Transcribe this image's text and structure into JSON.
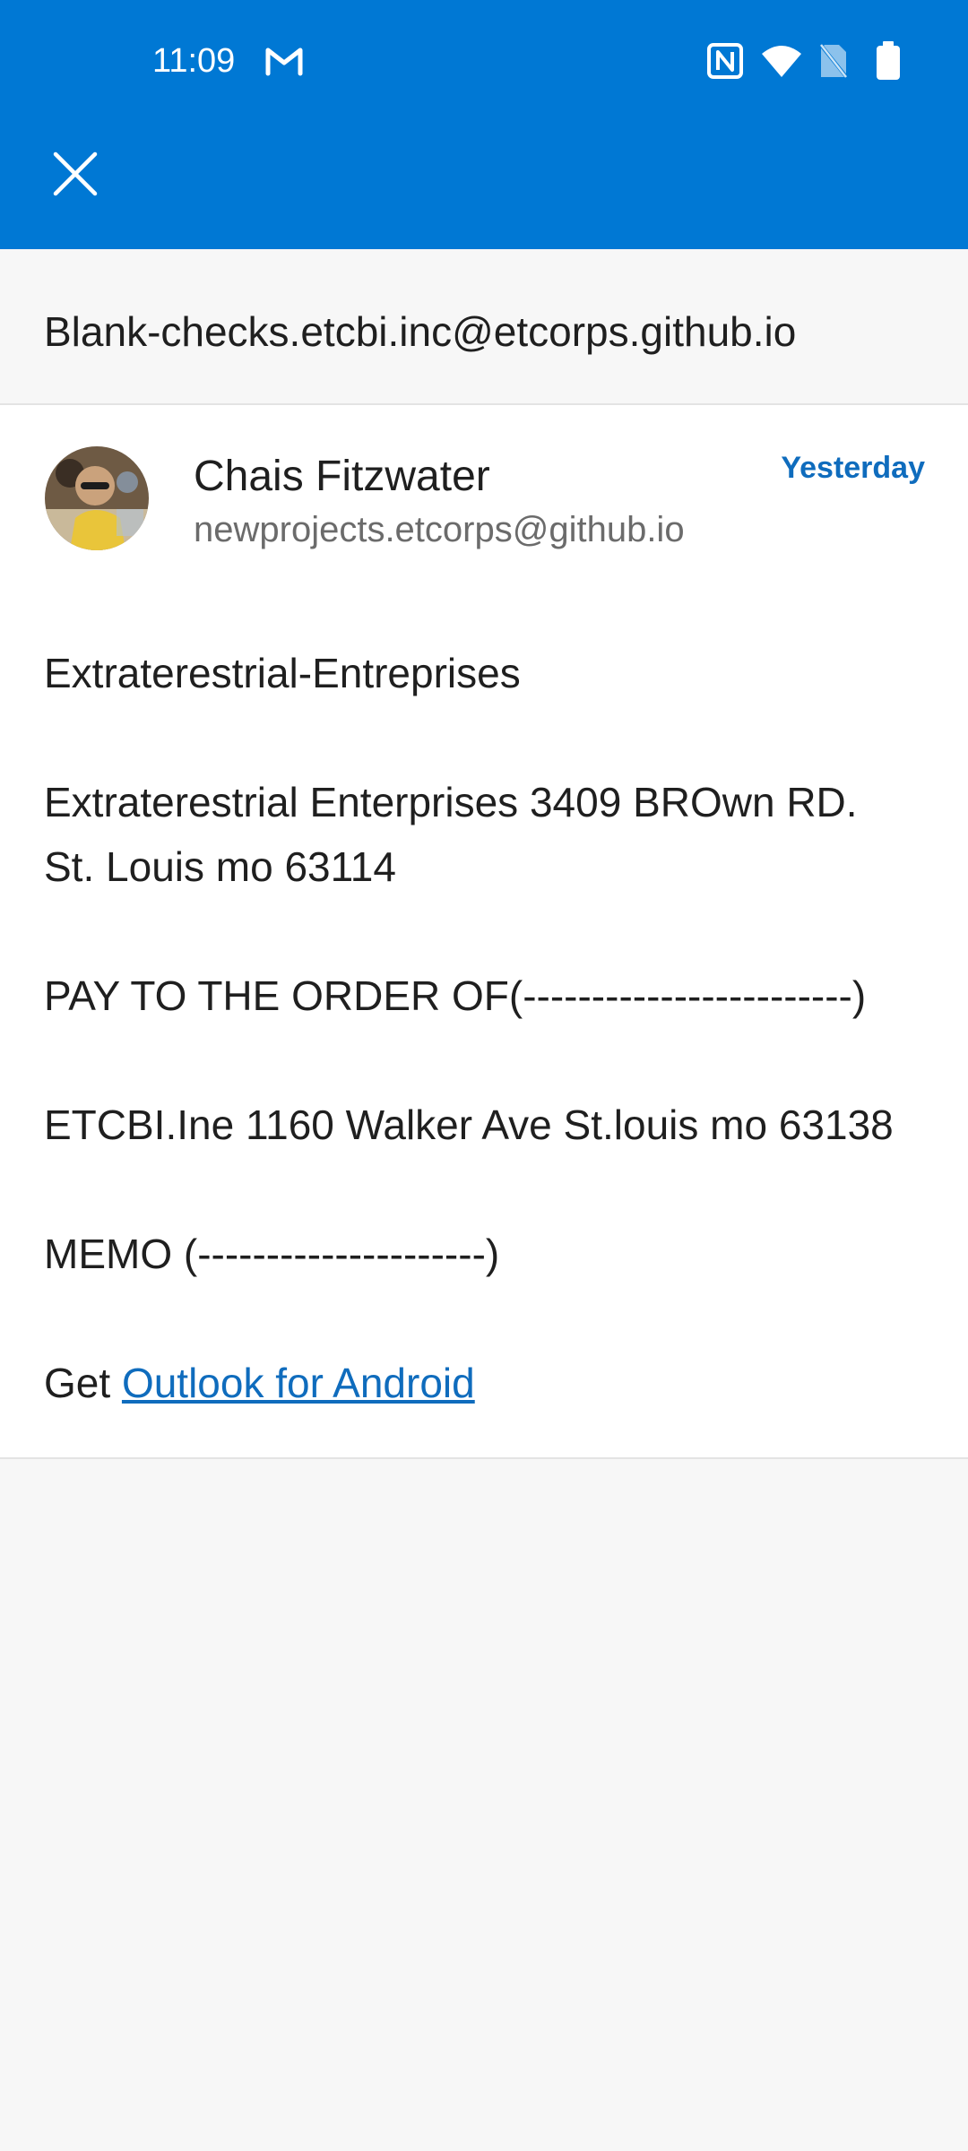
{
  "status_bar": {
    "time": "11:09",
    "icons": [
      "gmail-icon",
      "nfc-icon",
      "wifi-icon",
      "no-sim-icon",
      "battery-icon"
    ]
  },
  "app_bar": {
    "close_icon": "close-icon",
    "color": "#0078d4"
  },
  "subject": "Blank-checks.etcbi.inc@etcorps.github.io",
  "message": {
    "sender_name": "Chais Fitzwater",
    "sender_email": "newprojects.etcorps@github.io",
    "date": "Yesterday",
    "body": {
      "line1": "Extraterestrial-Entreprises",
      "line2": "Extraterestrial Enterprises 3409 BROwn RD.",
      "line3": "St. Louis mo 63114",
      "line4": "PAY TO THE ORDER OF(------------------------)",
      "line5": "ETCBI.Ine 1160 Walker Ave St.louis mo 63138",
      "line6": "MEMO (---------------------)"
    },
    "footer": {
      "prefix": "Get ",
      "link_text": "Outlook for Android"
    }
  },
  "colors": {
    "accent": "#0078d4",
    "link": "#0f6cbd",
    "background": "#f7f7f7"
  }
}
